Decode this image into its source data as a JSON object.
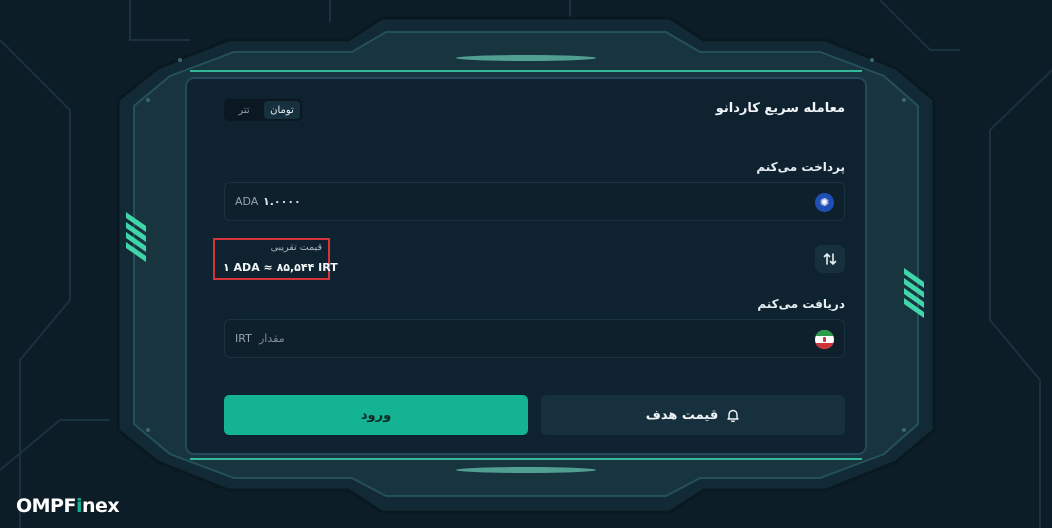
{
  "widget": {
    "title": "معامله سریع کاردانو",
    "segment": {
      "active": "تومان",
      "inactive": "تتر"
    }
  },
  "pay": {
    "label": "پرداخت می‌کنم",
    "unit": "ADA",
    "value": "۱.۰۰۰۰",
    "icon": "cardano-coin-icon"
  },
  "approx_price": {
    "label": "قیمت تقریبی",
    "value": "۱ ADA ≈ ۸۵,۵۴۴ IRT"
  },
  "receive": {
    "label": "دریافت می‌کنم",
    "unit": "IRT",
    "placeholder": "مقدار",
    "icon": "iran-flag-icon"
  },
  "buttons": {
    "login": "ورود",
    "target_price": "قیمت هدف"
  },
  "brand": {
    "logo": "OMPFinex"
  },
  "colors": {
    "accent": "#13b394",
    "highlight_border": "#d8333a",
    "background": "#0c1d27"
  }
}
